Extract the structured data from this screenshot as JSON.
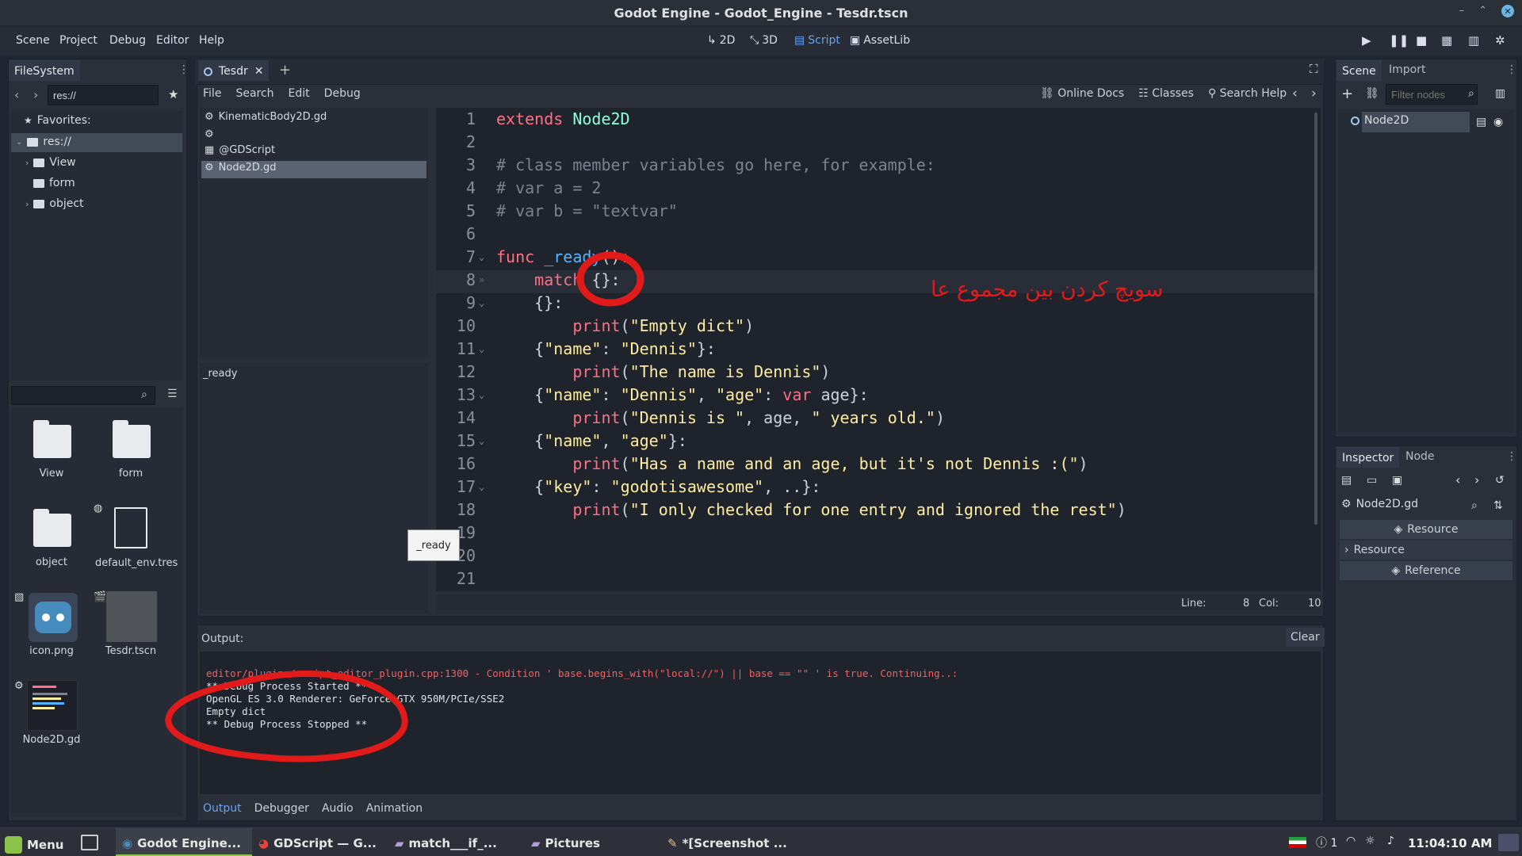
{
  "window": {
    "title": "Godot Engine - Godot_Engine - Tesdr.tscn"
  },
  "menu": [
    "Scene",
    "Project",
    "Debug",
    "Editor",
    "Help"
  ],
  "workspaces": [
    {
      "label": "2D",
      "icon": "2d-icon"
    },
    {
      "label": "3D",
      "icon": "3d-icon"
    },
    {
      "label": "Script",
      "icon": "script-icon",
      "active": true
    },
    {
      "label": "AssetLib",
      "icon": "assetlib-icon"
    }
  ],
  "filesystem": {
    "tab": "FileSystem",
    "path": "res://",
    "favorites_label": "Favorites:",
    "tree": [
      "res://",
      "View",
      "form",
      "object"
    ],
    "grid": [
      {
        "name": "View"
      },
      {
        "name": "form"
      },
      {
        "name": "object"
      },
      {
        "name": "default_env.tres"
      },
      {
        "name": "icon.png"
      },
      {
        "name": "Tesdr.tscn"
      },
      {
        "name": "Node2D.gd"
      }
    ]
  },
  "script_editor": {
    "tab": "Tesdr",
    "menus": [
      "File",
      "Search",
      "Edit",
      "Debug"
    ],
    "help_links": [
      "Online Docs",
      "Classes",
      "Search Help"
    ],
    "script_list": [
      "KinematicBody2D.gd",
      "",
      "@GDScript",
      "Node2D.gd"
    ],
    "methods": [
      "_ready"
    ],
    "tooltip": "_ready",
    "status": {
      "line_label": "Line:",
      "line": "8",
      "col_label": "Col:",
      "col": "10"
    },
    "annotation": "سویچ کردن بین مجموع عا"
  },
  "output": {
    "label": "Output:",
    "clear": "Clear",
    "lines": [
      "editor/plugins/script_editor_plugin.cpp:1300 - Condition ' base.begins_with(\"local://\") || base == \"\" ' is true. Continuing..:",
      "** Debug Process Started **",
      "OpenGL ES 3.0 Renderer: GeForce GTX 950M/PCIe/SSE2",
      "Empty dict",
      "** Debug Process Stopped **"
    ],
    "tabs": [
      "Output",
      "Debugger",
      "Audio",
      "Animation"
    ]
  },
  "scene": {
    "tabs": [
      "Scene",
      "Import"
    ],
    "filter_placeholder": "Filter nodes",
    "root": "Node2D"
  },
  "inspector": {
    "tabs": [
      "Inspector",
      "Node"
    ],
    "object": "Node2D.gd",
    "rows": [
      "Resource",
      "Resource",
      "Reference"
    ]
  },
  "taskbar": {
    "menu": "Menu",
    "items": [
      "Godot Engine...",
      "GDScript — G...",
      "match___if_...",
      "Pictures",
      "*[Screenshot ..."
    ],
    "notif": "1",
    "clock": "11:04:10 AM"
  },
  "colors": {
    "keyword": "#ff7085",
    "string": "#ffeda1",
    "comment": "#7d8290",
    "class": "#8effda",
    "accent": "#6aa3f0",
    "markup": "#e11a1a"
  }
}
